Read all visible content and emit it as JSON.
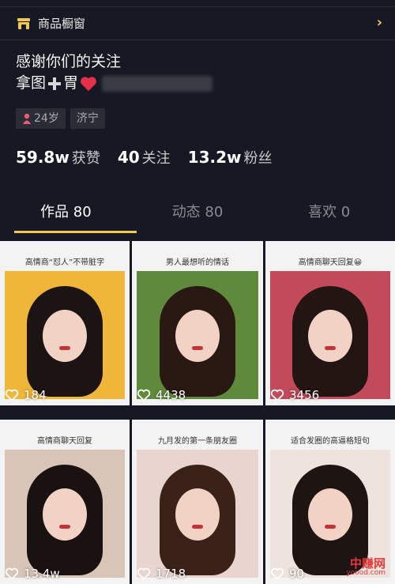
{
  "shop": {
    "label": "商品橱窗"
  },
  "bio": {
    "line1": "感谢你们的关注",
    "line2_prefix": "拿图",
    "line2_suffix": "胃"
  },
  "tags": [
    {
      "label": "24岁"
    },
    {
      "label": "济宁"
    }
  ],
  "stats": [
    {
      "value": "59.8w",
      "label": "获赞"
    },
    {
      "value": "40",
      "label": "关注"
    },
    {
      "value": "13.2w",
      "label": "粉丝"
    }
  ],
  "tabs": [
    {
      "label": "作品 80"
    },
    {
      "label": "动态 80"
    },
    {
      "label": "喜欢 0"
    }
  ],
  "posts": [
    {
      "title": "高情商“怼人”不带脏字",
      "likes": "184",
      "bg": "#f0b63a"
    },
    {
      "title": "男人最想听的情话",
      "likes": "4438",
      "bg": "#5f8a3c"
    },
    {
      "title": "高情商聊天回复😀",
      "likes": "3456",
      "bg": "#c24a5a"
    },
    {
      "title": "高情商聊天回复",
      "likes": "13.4w",
      "bg": "#d9c4b8"
    },
    {
      "title": "九月发的第一条朋友圈",
      "likes": "1718",
      "bg": "#e8d5cf"
    },
    {
      "title": "适合发圈的高逼格短句",
      "likes": "90",
      "bg": "#efe3de"
    }
  ],
  "watermark": {
    "main": "中赚网",
    "sub": "yoood.com"
  },
  "colors": {
    "background": "#161823",
    "accent": "#f2c94c",
    "heart": "#e8304a"
  }
}
